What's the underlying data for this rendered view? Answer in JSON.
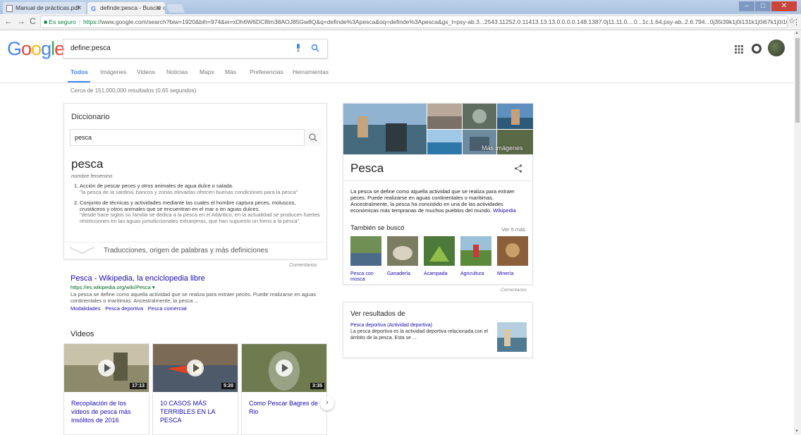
{
  "browser": {
    "tabs": [
      {
        "title": "Manual de prácticas.pdf"
      },
      {
        "title": "definde:pesca - Buscar co"
      }
    ],
    "secure_label": "Es seguro",
    "url_protocol": "https://",
    "url_rest": "www.google.com/search?biw=1920&bih=974&ei=xDh6W6DC8lm38AOJ85Gw8Q&q=definde%3Apesca&oq=definde%3Apesca&gs_l=psy-ab.3...2543.11252.0.11413.13.13.0.0.0.0.148.1387.0j11.11.0....0...1c.1.64.psy-ab..2.6.794...0j35i39k1j0i131k1j0i67k1j0i10k1j..."
  },
  "header": {
    "logo": [
      "G",
      "o",
      "o",
      "g",
      "l",
      "e"
    ],
    "query": "define:pesca",
    "tabs": [
      "Todos",
      "Imágenes",
      "Videos",
      "Noticias",
      "Maps",
      "Más",
      "Preferencias",
      "Herramientas"
    ],
    "result_count": "Cerca de 151,000,000 resultados (0.65 segundos)"
  },
  "dictionary": {
    "heading": "Diccionario",
    "input_value": "pesca",
    "word": "pesca",
    "pos": "nombre femenino",
    "defs": [
      {
        "num": "1.",
        "text": "Acción de pescar peces y otros animales de agua dulce o salada.",
        "example": "\"la pesca de la sardina; bancos y zonas elevadas ofrecen buenas condiciones para la pesca\""
      },
      {
        "num": "2.",
        "text": "Conjunto de técnicas y actividades mediante las cuales el hombre captura peces, moluscos, crustáceos y otros animales que se encuentran en el mar o en aguas dulces.",
        "example": "\"desde hace siglos su familia se dedica a la pesca en el Atlántico, en la actualidad se producen fuertes restricciones en las aguas jurisdiccionales extranjeras, que han supuesto un freno a la pesca\""
      }
    ],
    "more_label": "Traducciones, origen de palabras y más definiciones",
    "feedback": "Comentarios"
  },
  "result": {
    "title": "Pesca - Wikipedia, la enciclopedia libre",
    "url": "https://es.wikipedia.org/wiki/Pesca ▾",
    "snippet": "La pesca se define como aquella actividad que se realiza para extraer peces. Puede realizarse en aguas continentales o marítimas. Ancestralmente, la pesca ...",
    "links": [
      "Modalidades",
      "Pesca deportiva",
      "Pesca comercial"
    ],
    "link_sep": " · "
  },
  "videos": {
    "heading": "Videos",
    "items": [
      {
        "title": "Recopilación de los videos de pesca más insólitos de 2016",
        "duration": "17:13"
      },
      {
        "title": "10 CASOS MÁS TERRIBLES EN LA PESCA",
        "duration": "5:20"
      },
      {
        "title": "Como Pescar Bagres de Rio",
        "duration": "3:35"
      }
    ],
    "next_label": "›"
  },
  "knowledge": {
    "more_images": "Más imágenes",
    "title": "Pesca",
    "description": "La pesca se define como aquella actividad que se realiza para extraer peces. Puede realizarse en aguas continentales o marítimas. Ancestralmente, la pesca ha consistido en una de las actividades económicas más tempranas de muchos pueblos del mundo.",
    "wiki_link": "Wikipedia",
    "also_heading": "También se buscó",
    "see_more": "Ver 5 más",
    "related": [
      {
        "label": "Pesca con mosca"
      },
      {
        "label": "Ganadería"
      },
      {
        "label": "Acampada"
      },
      {
        "label": "Agricultura"
      },
      {
        "label": "Minería"
      }
    ],
    "feedback": "Comentarios"
  },
  "see_results": {
    "heading": "Ver resultados de",
    "sub": "Pesca deportiva (Actividad deportiva)",
    "text": "La pesca deportiva es la actividad deportiva relacionada con el ámbito de la pesca. Esta se ..."
  }
}
